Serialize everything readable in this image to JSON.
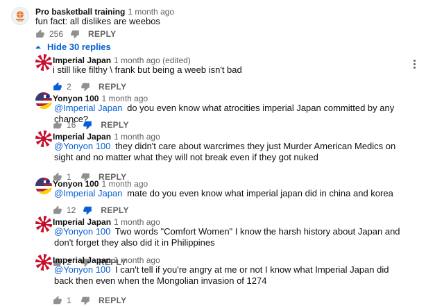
{
  "top_comment": {
    "author": "Pro basketball training",
    "time": "1 month ago",
    "text": "fun fact: all dislikes are weebos",
    "likes": "256",
    "reply_label": "REPLY"
  },
  "replies_toggle": {
    "label": "Hide 30 replies"
  },
  "replies": [
    {
      "author": "Imperial Japan",
      "time": "1 month ago (edited)",
      "mention": "",
      "text": "i still like filthy \\ frank but being a weeb isn't bad",
      "likes": "2",
      "liked": true,
      "disliked": false,
      "reply_label": "REPLY",
      "avatar": "rising-sun"
    },
    {
      "author": "Yonyon 100",
      "time": "1 month ago",
      "mention": "@Imperial Japan",
      "text": "do you even know what atrocities imperial Japan committed by any chance?",
      "likes": "16",
      "liked": false,
      "disliked": true,
      "reply_label": "REPLY",
      "avatar": "flag"
    },
    {
      "author": "Imperial Japan",
      "time": "1 month ago",
      "mention": "@Yonyon 100",
      "text": "they didn't care about warcrimes they just Murder American Medics on sight and no matter what they will not break even if they got nuked",
      "likes": "1",
      "liked": false,
      "disliked": false,
      "reply_label": "REPLY",
      "avatar": "rising-sun"
    },
    {
      "author": "Yonyon 100",
      "time": "1 month ago",
      "mention": "@Imperial Japan",
      "text": "mate do you even know what imperial japan did in china and korea",
      "likes": "12",
      "liked": false,
      "disliked": true,
      "reply_label": "REPLY",
      "avatar": "flag"
    },
    {
      "author": "Imperial Japan",
      "time": "1 month ago",
      "mention": "@Yonyon 100",
      "text": "Two words \"Comfort Women\" I know the harsh history about Japan and don't forget they also did it in Philippines",
      "likes": "2",
      "liked": false,
      "disliked": false,
      "reply_label": "REPLY",
      "avatar": "rising-sun"
    },
    {
      "author": "Imperial Japan",
      "time": "1 month ago",
      "mention": "@Yonyon 100",
      "text": "I can't tell if you're angry at me or not I know what Imperial Japan did back then even when the Mongolian invasion of 1274",
      "likes": "1",
      "liked": false,
      "disliked": false,
      "reply_label": "REPLY",
      "avatar": "rising-sun"
    }
  ],
  "colors": {
    "link": "#065fd4",
    "secondary": "#606060",
    "active": "#065fd4"
  }
}
